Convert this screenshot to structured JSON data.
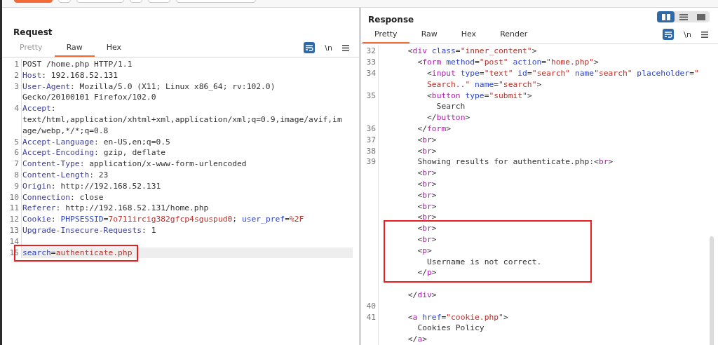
{
  "top_toolbar": {
    "buttons": [
      {
        "kind": "primary"
      },
      {
        "kind": "small"
      },
      {
        "kind": "wide"
      },
      {
        "kind": "small"
      },
      {
        "kind": "small"
      },
      {
        "kind": "field"
      }
    ]
  },
  "request": {
    "title": "Request",
    "tabs": [
      {
        "label": "Pretty",
        "selected": false,
        "disabled": true
      },
      {
        "label": "Raw",
        "selected": true,
        "disabled": false
      },
      {
        "label": "Hex",
        "selected": false,
        "disabled": false
      }
    ],
    "tools": {
      "wrap_on": true,
      "newline_label": "\\n"
    },
    "rows": [
      {
        "kind": "line",
        "number": "1",
        "current": false,
        "segments": [
          {
            "kind": "plain",
            "text": "POST /home.php HTTP/1.1"
          }
        ]
      },
      {
        "kind": "line",
        "number": "2",
        "current": false,
        "segments": [
          {
            "kind": "header",
            "text": "Host"
          },
          {
            "kind": "plain",
            "text": ": 192.168.52.131"
          }
        ]
      },
      {
        "kind": "line",
        "number": "3",
        "current": false,
        "segments": [
          {
            "kind": "header",
            "text": "User-Agent"
          },
          {
            "kind": "plain",
            "text": ": Mozilla/5.0 (X11; Linux x86_64; rv:102.0)"
          }
        ]
      },
      {
        "kind": "line",
        "current": false,
        "segments": [
          {
            "kind": "plain",
            "text": "Gecko/20100101 Firefox/102.0"
          }
        ]
      },
      {
        "kind": "line",
        "number": "4",
        "current": false,
        "segments": [
          {
            "kind": "header",
            "text": "Accept"
          },
          {
            "kind": "plain",
            "text": ":"
          }
        ]
      },
      {
        "kind": "line",
        "current": false,
        "segments": [
          {
            "kind": "plain",
            "text": "text/html,application/xhtml+xml,application/xml;q=0.9,image/avif,im"
          }
        ]
      },
      {
        "kind": "line",
        "current": false,
        "segments": [
          {
            "kind": "plain",
            "text": "age/webp,*/*;q=0.8"
          }
        ]
      },
      {
        "kind": "line",
        "number": "5",
        "current": false,
        "segments": [
          {
            "kind": "header",
            "text": "Accept-Language"
          },
          {
            "kind": "plain",
            "text": ": en-US,en;q=0.5"
          }
        ]
      },
      {
        "kind": "line",
        "number": "6",
        "current": false,
        "segments": [
          {
            "kind": "header",
            "text": "Accept-Encoding"
          },
          {
            "kind": "plain",
            "text": ": gzip, deflate"
          }
        ]
      },
      {
        "kind": "line",
        "number": "7",
        "current": false,
        "segments": [
          {
            "kind": "header",
            "text": "Content-Type"
          },
          {
            "kind": "plain",
            "text": ": application/x-www-form-urlencoded"
          }
        ]
      },
      {
        "kind": "line",
        "number": "8",
        "current": false,
        "segments": [
          {
            "kind": "header",
            "text": "Content-Length"
          },
          {
            "kind": "plain",
            "text": ": 23"
          }
        ]
      },
      {
        "kind": "line",
        "number": "9",
        "current": false,
        "segments": [
          {
            "kind": "header",
            "text": "Origin"
          },
          {
            "kind": "plain",
            "text": ": http://192.168.52.131"
          }
        ]
      },
      {
        "kind": "line",
        "number": "10",
        "current": false,
        "segments": [
          {
            "kind": "header",
            "text": "Connection"
          },
          {
            "kind": "plain",
            "text": ": close"
          }
        ]
      },
      {
        "kind": "line",
        "number": "11",
        "current": false,
        "segments": [
          {
            "kind": "header",
            "text": "Referer"
          },
          {
            "kind": "plain",
            "text": ": http://192.168.52.131/home.php"
          }
        ]
      },
      {
        "kind": "line",
        "number": "12",
        "current": false,
        "segments": [
          {
            "kind": "header",
            "text": "Cookie"
          },
          {
            "kind": "plain",
            "text": ": "
          },
          {
            "kind": "param",
            "text": "PHPSESSID"
          },
          {
            "kind": "plain",
            "text": "="
          },
          {
            "kind": "value",
            "text": "7o711ircig382gfcp4sguspud0"
          },
          {
            "kind": "plain",
            "text": "; "
          },
          {
            "kind": "param",
            "text": "user_pref"
          },
          {
            "kind": "plain",
            "text": "="
          },
          {
            "kind": "value",
            "text": "%2F"
          }
        ]
      },
      {
        "kind": "line",
        "number": "13",
        "current": false,
        "segments": [
          {
            "kind": "header",
            "text": "Upgrade-Insecure-Requests"
          },
          {
            "kind": "plain",
            "text": ": 1"
          }
        ]
      },
      {
        "kind": "line",
        "number": "14",
        "current": false,
        "segments": []
      },
      {
        "kind": "highlight",
        "rows": [
          {
            "number": "15",
            "current": true,
            "segments": [
              {
                "kind": "param",
                "text": "search"
              },
              {
                "kind": "plain",
                "text": "="
              },
              {
                "kind": "value",
                "text": "authenticate.php"
              }
            ]
          }
        ]
      }
    ]
  },
  "response": {
    "title": "Response",
    "layout_buttons": [
      {
        "kind": "columns",
        "selected": true
      },
      {
        "kind": "rows",
        "selected": false
      },
      {
        "kind": "single",
        "selected": false
      }
    ],
    "tabs": [
      {
        "label": "Pretty",
        "selected": true,
        "disabled": false
      },
      {
        "label": "Raw",
        "selected": false,
        "disabled": false
      },
      {
        "label": "Hex",
        "selected": false,
        "disabled": false
      },
      {
        "label": "Render",
        "selected": false,
        "disabled": false
      }
    ],
    "tools": {
      "wrap_on": true,
      "newline_label": "\\n"
    },
    "rows": [
      {
        "kind": "line",
        "number": "32",
        "current": false,
        "segments": [
          {
            "kind": "plain",
            "text": "      <"
          },
          {
            "kind": "tag",
            "text": "div"
          },
          {
            "kind": "attr",
            "text": " class"
          },
          {
            "kind": "plain",
            "text": "="
          },
          {
            "kind": "string",
            "text": "\"inner_content\""
          },
          {
            "kind": "plain",
            "text": ">"
          }
        ]
      },
      {
        "kind": "line",
        "number": "33",
        "current": false,
        "segments": [
          {
            "kind": "plain",
            "text": "        <"
          },
          {
            "kind": "tag",
            "text": "form"
          },
          {
            "kind": "attr",
            "text": " method"
          },
          {
            "kind": "plain",
            "text": "="
          },
          {
            "kind": "string",
            "text": "\"post\""
          },
          {
            "kind": "attr",
            "text": " action"
          },
          {
            "kind": "plain",
            "text": "="
          },
          {
            "kind": "string",
            "text": "\"home.php\""
          },
          {
            "kind": "plain",
            "text": ">"
          }
        ]
      },
      {
        "kind": "line",
        "number": "34",
        "current": false,
        "segments": [
          {
            "kind": "plain",
            "text": "          <"
          },
          {
            "kind": "tag",
            "text": "input"
          },
          {
            "kind": "attr",
            "text": " type"
          },
          {
            "kind": "plain",
            "text": "="
          },
          {
            "kind": "string",
            "text": "\"text\""
          },
          {
            "kind": "attr",
            "text": " id"
          },
          {
            "kind": "plain",
            "text": "="
          },
          {
            "kind": "string",
            "text": "\"search\""
          },
          {
            "kind": "attr",
            "text": " name"
          },
          {
            "kind": "string",
            "text": "\"search\""
          },
          {
            "kind": "attr",
            "text": " placeholder"
          },
          {
            "kind": "plain",
            "text": "="
          },
          {
            "kind": "string",
            "text": "\""
          }
        ]
      },
      {
        "kind": "line",
        "current": false,
        "segments": [
          {
            "kind": "string",
            "text": "          Search..\""
          },
          {
            "kind": "attr",
            "text": " name"
          },
          {
            "kind": "plain",
            "text": "="
          },
          {
            "kind": "string",
            "text": "\"search\""
          },
          {
            "kind": "plain",
            "text": ">"
          }
        ]
      },
      {
        "kind": "line",
        "number": "35",
        "current": false,
        "segments": [
          {
            "kind": "plain",
            "text": "          <"
          },
          {
            "kind": "tag",
            "text": "button"
          },
          {
            "kind": "attr",
            "text": " type"
          },
          {
            "kind": "plain",
            "text": "="
          },
          {
            "kind": "string",
            "text": "\"submit\""
          },
          {
            "kind": "plain",
            "text": ">"
          }
        ]
      },
      {
        "kind": "line",
        "current": false,
        "segments": [
          {
            "kind": "plain",
            "text": "            Search"
          }
        ]
      },
      {
        "kind": "line",
        "current": false,
        "segments": [
          {
            "kind": "plain",
            "text": "          </"
          },
          {
            "kind": "tag",
            "text": "button"
          },
          {
            "kind": "plain",
            "text": ">"
          }
        ]
      },
      {
        "kind": "line",
        "number": "36",
        "current": false,
        "segments": [
          {
            "kind": "plain",
            "text": "        </"
          },
          {
            "kind": "tag",
            "text": "form"
          },
          {
            "kind": "plain",
            "text": ">"
          }
        ]
      },
      {
        "kind": "line",
        "number": "37",
        "current": false,
        "segments": [
          {
            "kind": "plain",
            "text": "        <"
          },
          {
            "kind": "tag",
            "text": "br"
          },
          {
            "kind": "plain",
            "text": ">"
          }
        ]
      },
      {
        "kind": "line",
        "number": "38",
        "current": false,
        "segments": [
          {
            "kind": "plain",
            "text": "        <"
          },
          {
            "kind": "tag",
            "text": "br"
          },
          {
            "kind": "plain",
            "text": ">"
          }
        ]
      },
      {
        "kind": "line",
        "number": "39",
        "current": false,
        "segments": [
          {
            "kind": "plain",
            "text": "        Showing results for authenticate.php:<"
          },
          {
            "kind": "tag",
            "text": "br"
          },
          {
            "kind": "plain",
            "text": ">"
          }
        ]
      },
      {
        "kind": "line",
        "current": false,
        "segments": [
          {
            "kind": "plain",
            "text": "        <"
          },
          {
            "kind": "tag",
            "text": "br"
          },
          {
            "kind": "plain",
            "text": ">"
          }
        ]
      },
      {
        "kind": "line",
        "current": false,
        "segments": [
          {
            "kind": "plain",
            "text": "        <"
          },
          {
            "kind": "tag",
            "text": "br"
          },
          {
            "kind": "plain",
            "text": ">"
          }
        ]
      },
      {
        "kind": "line",
        "current": false,
        "segments": [
          {
            "kind": "plain",
            "text": "        <"
          },
          {
            "kind": "tag",
            "text": "br"
          },
          {
            "kind": "plain",
            "text": ">"
          }
        ]
      },
      {
        "kind": "line",
        "current": false,
        "segments": [
          {
            "kind": "plain",
            "text": "        <"
          },
          {
            "kind": "tag",
            "text": "br"
          },
          {
            "kind": "plain",
            "text": ">"
          }
        ]
      },
      {
        "kind": "line",
        "current": false,
        "segments": [
          {
            "kind": "plain",
            "text": "        <"
          },
          {
            "kind": "tag",
            "text": "br"
          },
          {
            "kind": "plain",
            "text": ">"
          }
        ]
      },
      {
        "kind": "highlight",
        "rows": [
          {
            "current": false,
            "segments": [
              {
                "kind": "plain",
                "text": "        <"
              },
              {
                "kind": "tag",
                "text": "br"
              },
              {
                "kind": "plain",
                "text": ">"
              }
            ]
          },
          {
            "current": false,
            "segments": [
              {
                "kind": "plain",
                "text": "        <"
              },
              {
                "kind": "tag",
                "text": "br"
              },
              {
                "kind": "plain",
                "text": ">"
              }
            ]
          },
          {
            "current": false,
            "segments": [
              {
                "kind": "plain",
                "text": "        <"
              },
              {
                "kind": "tag",
                "text": "p"
              },
              {
                "kind": "plain",
                "text": ">"
              }
            ]
          },
          {
            "current": false,
            "segments": [
              {
                "kind": "plain",
                "text": "          Username is not correct."
              }
            ]
          },
          {
            "current": false,
            "segments": [
              {
                "kind": "plain",
                "text": "        </"
              },
              {
                "kind": "tag",
                "text": "p"
              },
              {
                "kind": "plain",
                "text": ">"
              }
            ]
          }
        ]
      },
      {
        "kind": "line",
        "current": false,
        "segments": []
      },
      {
        "kind": "line",
        "current": false,
        "segments": [
          {
            "kind": "plain",
            "text": "      </"
          },
          {
            "kind": "tag",
            "text": "div"
          },
          {
            "kind": "plain",
            "text": ">"
          }
        ]
      },
      {
        "kind": "line",
        "number": "40",
        "current": false,
        "segments": []
      },
      {
        "kind": "line",
        "number": "41",
        "current": false,
        "segments": [
          {
            "kind": "plain",
            "text": "      <"
          },
          {
            "kind": "tag",
            "text": "a"
          },
          {
            "kind": "attr",
            "text": " href"
          },
          {
            "kind": "plain",
            "text": "="
          },
          {
            "kind": "string",
            "text": "\"cookie.php\""
          },
          {
            "kind": "plain",
            "text": ">"
          }
        ]
      },
      {
        "kind": "line",
        "current": false,
        "segments": [
          {
            "kind": "plain",
            "text": "        Cookies Policy"
          }
        ]
      },
      {
        "kind": "line",
        "current": false,
        "segments": [
          {
            "kind": "plain",
            "text": "      </"
          },
          {
            "kind": "tag",
            "text": "a"
          },
          {
            "kind": "plain",
            "text": ">"
          }
        ]
      }
    ]
  }
}
